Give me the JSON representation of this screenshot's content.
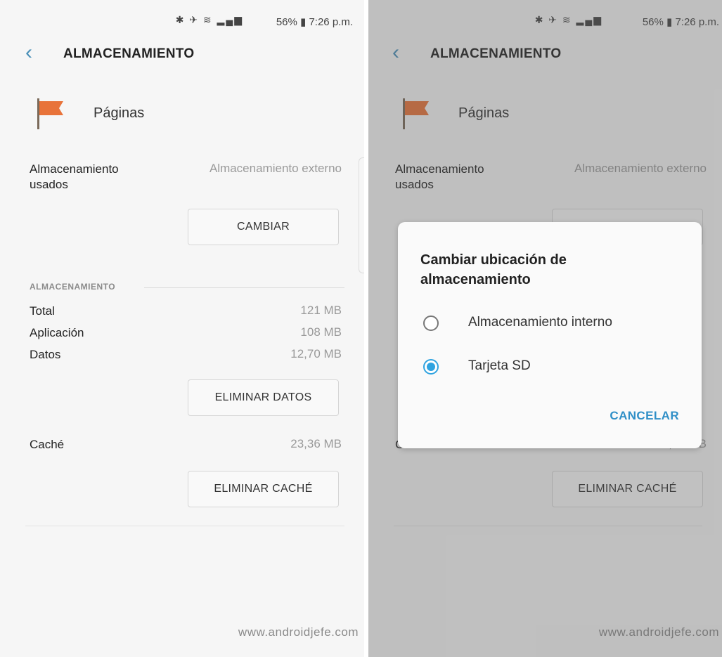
{
  "status": {
    "icons": "✱ ✈ ≋ ▂▄▆",
    "battery": "56%",
    "time": "7:26 p.m."
  },
  "header": {
    "title": "ALMACENAMIENTO"
  },
  "app": {
    "name": "Páginas"
  },
  "storage_used": {
    "label_line1": "Almacenamiento",
    "label_line2": "usados",
    "value": "Almacenamiento externo",
    "button": "CAMBIAR"
  },
  "section": {
    "label": "ALMACENAMIENTO"
  },
  "stats": [
    {
      "label": "Total",
      "value": "121 MB"
    },
    {
      "label": "Aplicación",
      "value": "108 MB"
    },
    {
      "label": "Datos",
      "value": "12,70 MB"
    }
  ],
  "clear_data_button": "ELIMINAR DATOS",
  "cache": {
    "label": "Caché",
    "value": "23,36 MB",
    "button": "ELIMINAR CACHÉ"
  },
  "watermark": "www.androidjefe.com",
  "dialog": {
    "title": "Cambiar ubicación de almacenamiento",
    "options": [
      {
        "label": "Almacenamiento interno",
        "selected": false
      },
      {
        "label": "Tarjeta SD",
        "selected": true
      }
    ],
    "cancel": "CANCELAR"
  },
  "colors": {
    "accent": "#2fa3e0",
    "flag": "#e8733a",
    "background": "#f6f6f6"
  }
}
